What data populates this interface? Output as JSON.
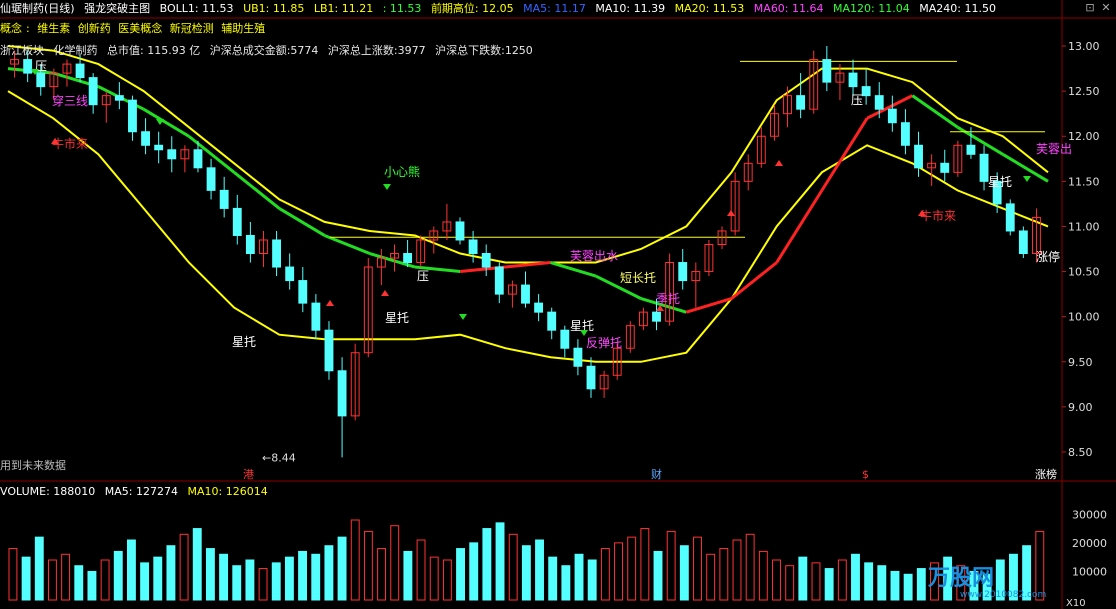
{
  "header": {
    "stock_name": "仙琚制药(日线)",
    "indicator_name": "强龙突破主图",
    "boll1": "BOLL1: 11.53",
    "ub1": "UB1: 11.85",
    "lb1": "LB1: 11.21",
    "extra": ": 11.53",
    "prev_high": "前期高位: 12.05",
    "ma5": "MA5: 11.17",
    "ma10": "MA10: 11.39",
    "ma20": "MA20: 11.53",
    "ma60": "MA60: 11.64",
    "ma120": "MA120: 11.04",
    "ma240": "MA240: 11.50"
  },
  "concepts": {
    "label": "概念",
    "items": [
      "维生素",
      "创新药",
      "医美概念",
      "新冠检测",
      "辅助生殖"
    ]
  },
  "info_row": {
    "sector_label": "浙江板块",
    "industry": "化学制药",
    "market_value": "总市值: 115.93 亿",
    "turnover": "沪深总成交金额:5774",
    "up_count": "沪深总上涨数:3977",
    "down_count": "沪深总下跌数:1250"
  },
  "future_note": "用到未来数据",
  "volume_header": {
    "volume": "VOLUME: 188010",
    "ma5": "MA5: 127274",
    "ma10": "MA10: 126014"
  },
  "price_axis": [
    "13.00",
    "12.50",
    "12.00",
    "11.50",
    "11.00",
    "10.50",
    "10.00",
    "9.50",
    "9.00",
    "8.50"
  ],
  "volume_axis": [
    "30000",
    "20000",
    "10000"
  ],
  "volume_unit": "X10",
  "low_marker": "8.44",
  "event_tags": [
    {
      "text": "港",
      "color": "#ff3030"
    },
    {
      "text": "财",
      "color": "#5fa8ff"
    },
    {
      "text": "$",
      "color": "#ff3030"
    },
    {
      "text": "涨榜",
      "color": "#ffffff"
    }
  ],
  "annotations": [
    {
      "text": "压",
      "color": "#ffffff"
    },
    {
      "text": "穿三线",
      "color": "#ff44ff"
    },
    {
      "text": "牛市来",
      "color": "#ff3030"
    },
    {
      "text": "小心熊",
      "color": "#33ff33"
    },
    {
      "text": "星托",
      "color": "#ffffff"
    },
    {
      "text": "压",
      "color": "#ffffff"
    },
    {
      "text": "星托",
      "color": "#ffffff"
    },
    {
      "text": "芙蓉出水",
      "color": "#ff44ff"
    },
    {
      "text": "短长托",
      "color": "#ffff66"
    },
    {
      "text": "星托",
      "color": "#ffffff"
    },
    {
      "text": "反弹托",
      "color": "#ff44ff"
    },
    {
      "text": "季托",
      "color": "#ff44ff"
    },
    {
      "text": "压",
      "color": "#ffffff"
    },
    {
      "text": "牛市来",
      "color": "#ff3030"
    },
    {
      "text": "星托",
      "color": "#ffffff"
    },
    {
      "text": "芙蓉出",
      "color": "#ff44ff"
    },
    {
      "text": "涨停",
      "color": "#ffffff"
    }
  ],
  "watermark": "万股网",
  "watermark_url": "www.2010082.com",
  "colors": {
    "up": "#ff3333",
    "down": "#54ffff",
    "band": "#ffff00",
    "ma_green": "#22dd22",
    "ma_red": "#ff2222",
    "accent_magenta": "#ff44ff",
    "grid": "#8b0000"
  },
  "chart_data": {
    "type": "candlestick",
    "title": "仙琚制药(日线)",
    "ylim": [
      8.3,
      13.2
    ],
    "candles": [
      [
        12.8,
        12.95,
        12.65,
        12.85
      ],
      [
        12.85,
        12.95,
        12.6,
        12.7
      ],
      [
        12.7,
        12.8,
        12.45,
        12.55
      ],
      [
        12.55,
        12.75,
        12.4,
        12.7
      ],
      [
        12.7,
        12.85,
        12.55,
        12.8
      ],
      [
        12.8,
        12.9,
        12.6,
        12.65
      ],
      [
        12.65,
        12.7,
        12.25,
        12.35
      ],
      [
        12.35,
        12.5,
        12.15,
        12.45
      ],
      [
        12.45,
        12.6,
        12.3,
        12.4
      ],
      [
        12.4,
        12.45,
        11.95,
        12.05
      ],
      [
        12.05,
        12.2,
        11.8,
        11.9
      ],
      [
        11.9,
        12.05,
        11.7,
        11.85
      ],
      [
        11.85,
        12.0,
        11.6,
        11.75
      ],
      [
        11.75,
        11.9,
        11.6,
        11.85
      ],
      [
        11.85,
        11.95,
        11.6,
        11.65
      ],
      [
        11.65,
        11.75,
        11.3,
        11.4
      ],
      [
        11.4,
        11.55,
        11.1,
        11.2
      ],
      [
        11.2,
        11.35,
        10.8,
        10.9
      ],
      [
        10.9,
        11.05,
        10.6,
        10.7
      ],
      [
        10.7,
        10.95,
        10.55,
        10.85
      ],
      [
        10.85,
        10.95,
        10.45,
        10.55
      ],
      [
        10.55,
        10.7,
        10.3,
        10.4
      ],
      [
        10.4,
        10.55,
        10.05,
        10.15
      ],
      [
        10.15,
        10.25,
        9.75,
        9.85
      ],
      [
        9.85,
        9.95,
        9.3,
        9.4
      ],
      [
        9.4,
        9.55,
        8.44,
        8.9
      ],
      [
        8.9,
        9.7,
        8.85,
        9.6
      ],
      [
        9.6,
        10.65,
        9.55,
        10.55
      ],
      [
        10.55,
        10.75,
        10.35,
        10.65
      ],
      [
        10.65,
        10.8,
        10.5,
        10.7
      ],
      [
        10.7,
        10.85,
        10.55,
        10.6
      ],
      [
        10.6,
        10.9,
        10.55,
        10.85
      ],
      [
        10.85,
        11.0,
        10.7,
        10.95
      ],
      [
        10.95,
        11.25,
        10.85,
        11.05
      ],
      [
        11.05,
        11.1,
        10.8,
        10.85
      ],
      [
        10.85,
        10.95,
        10.6,
        10.7
      ],
      [
        10.7,
        10.8,
        10.45,
        10.55
      ],
      [
        10.55,
        10.6,
        10.15,
        10.25
      ],
      [
        10.25,
        10.4,
        10.1,
        10.35
      ],
      [
        10.35,
        10.5,
        10.1,
        10.15
      ],
      [
        10.15,
        10.25,
        9.95,
        10.05
      ],
      [
        10.05,
        10.1,
        9.75,
        9.85
      ],
      [
        9.85,
        9.9,
        9.55,
        9.65
      ],
      [
        9.65,
        9.75,
        9.35,
        9.45
      ],
      [
        9.45,
        9.55,
        9.1,
        9.2
      ],
      [
        9.2,
        9.4,
        9.1,
        9.35
      ],
      [
        9.35,
        9.7,
        9.3,
        9.65
      ],
      [
        9.65,
        9.95,
        9.6,
        9.9
      ],
      [
        9.9,
        10.1,
        9.85,
        10.05
      ],
      [
        10.05,
        10.2,
        9.85,
        9.95
      ],
      [
        9.95,
        10.7,
        9.9,
        10.6
      ],
      [
        10.6,
        10.75,
        10.3,
        10.4
      ],
      [
        10.4,
        10.6,
        10.1,
        10.5
      ],
      [
        10.5,
        10.85,
        10.45,
        10.8
      ],
      [
        10.8,
        11.0,
        10.75,
        10.95
      ],
      [
        10.95,
        11.6,
        10.9,
        11.5
      ],
      [
        11.5,
        11.8,
        11.4,
        11.7
      ],
      [
        11.7,
        12.1,
        11.65,
        12.0
      ],
      [
        12.0,
        12.35,
        11.95,
        12.25
      ],
      [
        12.25,
        12.55,
        12.1,
        12.45
      ],
      [
        12.45,
        12.7,
        12.2,
        12.3
      ],
      [
        12.3,
        12.95,
        12.25,
        12.85
      ],
      [
        12.85,
        13.0,
        12.5,
        12.6
      ],
      [
        12.6,
        12.8,
        12.4,
        12.7
      ],
      [
        12.7,
        12.85,
        12.45,
        12.55
      ],
      [
        12.55,
        12.75,
        12.35,
        12.45
      ],
      [
        12.45,
        12.6,
        12.2,
        12.3
      ],
      [
        12.3,
        12.45,
        12.05,
        12.15
      ],
      [
        12.15,
        12.3,
        11.8,
        11.9
      ],
      [
        11.9,
        12.05,
        11.55,
        11.65
      ],
      [
        11.65,
        11.8,
        11.45,
        11.7
      ],
      [
        11.7,
        11.85,
        11.5,
        11.6
      ],
      [
        11.6,
        11.95,
        11.55,
        11.9
      ],
      [
        11.9,
        12.1,
        11.75,
        11.8
      ],
      [
        11.8,
        11.9,
        11.4,
        11.5
      ],
      [
        11.5,
        11.6,
        11.15,
        11.25
      ],
      [
        11.25,
        11.3,
        10.9,
        10.95
      ],
      [
        10.95,
        11.0,
        10.65,
        10.7
      ],
      [
        10.7,
        11.2,
        10.6,
        11.1
      ]
    ],
    "band_upper": [
      13.0,
      12.95,
      12.8,
      12.5,
      12.1,
      11.7,
      11.3,
      11.05,
      10.95,
      10.9,
      10.7,
      10.6,
      10.6,
      10.6,
      10.75,
      11.0,
      11.6,
      12.4,
      12.75,
      12.75,
      12.6,
      12.2,
      12.0,
      11.6
    ],
    "band_lower": [
      12.5,
      12.2,
      11.8,
      11.2,
      10.6,
      10.1,
      9.8,
      9.75,
      9.75,
      9.75,
      9.8,
      9.65,
      9.55,
      9.5,
      9.5,
      9.6,
      10.2,
      11.0,
      11.6,
      11.9,
      11.7,
      11.4,
      11.2,
      11.0
    ],
    "ma_line": [
      12.75,
      12.7,
      12.55,
      12.3,
      12.0,
      11.6,
      11.2,
      10.9,
      10.7,
      10.55,
      10.5,
      10.55,
      10.6,
      10.45,
      10.2,
      10.05,
      10.2,
      10.6,
      11.4,
      12.2,
      12.45,
      12.1,
      11.8,
      11.5
    ],
    "volume": [
      18,
      15,
      22,
      14,
      16,
      12,
      10,
      14,
      17,
      21,
      13,
      15,
      19,
      23,
      25,
      18,
      16,
      12,
      14,
      11,
      13,
      15,
      17,
      16,
      19,
      22,
      28,
      24,
      18,
      26,
      17,
      21,
      15,
      14,
      18,
      20,
      25,
      27,
      23,
      19,
      21,
      15,
      12,
      16,
      14,
      18,
      20,
      22,
      25,
      17,
      24,
      19,
      22,
      16,
      18,
      21,
      23,
      17,
      14,
      12,
      15,
      13,
      11,
      14,
      16,
      13,
      12,
      10,
      9,
      11,
      13,
      15,
      12,
      10,
      9,
      14,
      16,
      19,
      24
    ],
    "volume_ylim": [
      0,
      35000
    ]
  }
}
